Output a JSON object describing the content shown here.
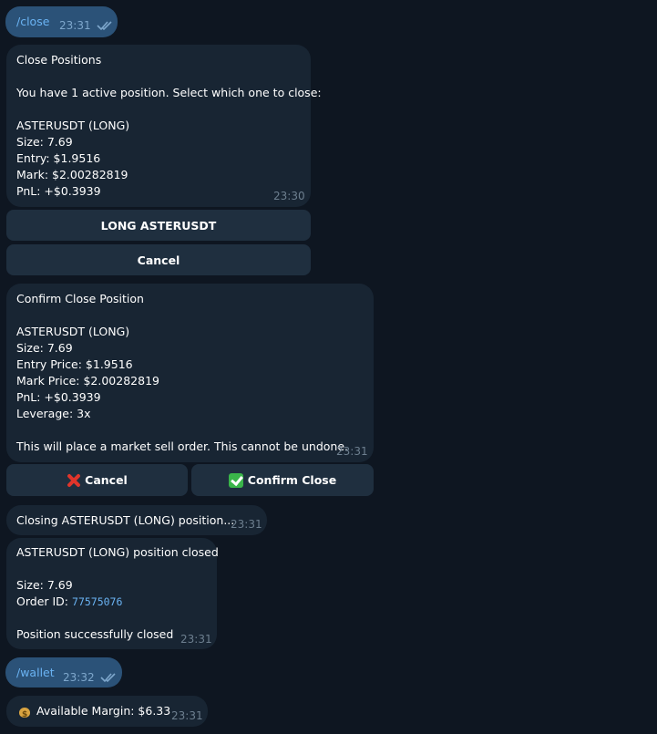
{
  "messages": {
    "cmd_close": {
      "text": "/close",
      "time": "23:31"
    },
    "positions": {
      "title": "Close Positions",
      "subtitle": "You have 1 active position. Select which one to close:",
      "pair": "ASTERUSDT (LONG)",
      "size": "Size: 7.69",
      "entry": "Entry: $1.9516",
      "mark": "Mark: $2.00282819",
      "pnl": "PnL: +$0.3939",
      "time": "23:30",
      "buttons": {
        "long": "LONG ASTERUSDT",
        "cancel": "Cancel"
      }
    },
    "confirm": {
      "title": "Confirm Close Position",
      "pair": "ASTERUSDT (LONG)",
      "size": "Size: 7.69",
      "entry": "Entry Price: $1.9516",
      "mark": "Mark Price: $2.00282819",
      "pnl": "PnL: +$0.3939",
      "leverage": "Leverage: 3x",
      "warning": "This will place a market sell order. This cannot be undone.",
      "time": "23:31",
      "buttons": {
        "cancel": "Cancel",
        "confirm": "Confirm Close"
      }
    },
    "closing": {
      "text": "Closing ASTERUSDT (LONG) position...",
      "time": "23:31"
    },
    "closed": {
      "title": "ASTERUSDT (LONG) position closed",
      "size": "Size: 7.69",
      "order_label": "Order ID:",
      "order_id": "77575076",
      "status": "Position successfully closed",
      "time": "23:31"
    },
    "cmd_wallet": {
      "text": "/wallet",
      "time": "23:32"
    },
    "margin": {
      "text": "Available Margin: $6.33",
      "time": "23:31"
    }
  },
  "colors": {
    "background": "#0e1621",
    "outgoing": "#2b5278",
    "incoming": "#182533",
    "button": "#1f2f3f",
    "link": "#6ab3f3"
  },
  "icons": [
    "double-check-icon",
    "cross-mark-icon",
    "check-mark-icon",
    "money-bag-icon"
  ]
}
